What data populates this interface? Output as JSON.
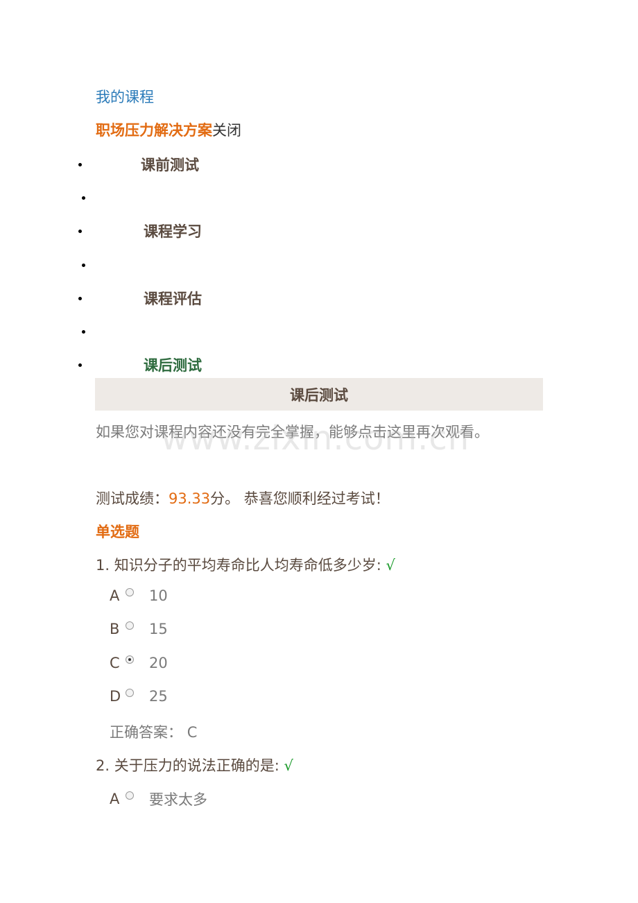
{
  "breadcrumb": {
    "my_courses": "我的课程"
  },
  "course": {
    "name": "职场压力解决方案",
    "close_label": "关闭"
  },
  "nav": {
    "items": [
      {
        "label": "课前测试"
      },
      {
        "label": "课程学习"
      },
      {
        "label": "课程评估"
      },
      {
        "label": "课后测试"
      }
    ]
  },
  "section_banner": {
    "title": "课后测试"
  },
  "review_prompt": "如果您对课程内容还没有完全掌握，能够点击这里再次观看。",
  "watermark": "www.zixin.com.cn",
  "result": {
    "prefix": "测试成绩：",
    "score": "93.33",
    "suffix": "分。 恭喜您顺利经过考试！"
  },
  "section_title": "单选题",
  "questions": [
    {
      "text": "1. 知识分子的平均寿命比人均寿命低多少岁:",
      "mark": "√",
      "options": [
        {
          "letter": "A",
          "value": "10",
          "selected": false
        },
        {
          "letter": "B",
          "value": "15",
          "selected": false
        },
        {
          "letter": "C",
          "value": "20",
          "selected": true
        },
        {
          "letter": "D",
          "value": "25",
          "selected": false
        }
      ],
      "answer_label": "正确答案：",
      "answer": "C"
    },
    {
      "text": "2. 关于压力的说法正确的是:",
      "mark": "√",
      "options": [
        {
          "letter": "A",
          "value": "要求太多",
          "selected": false
        }
      ]
    }
  ]
}
